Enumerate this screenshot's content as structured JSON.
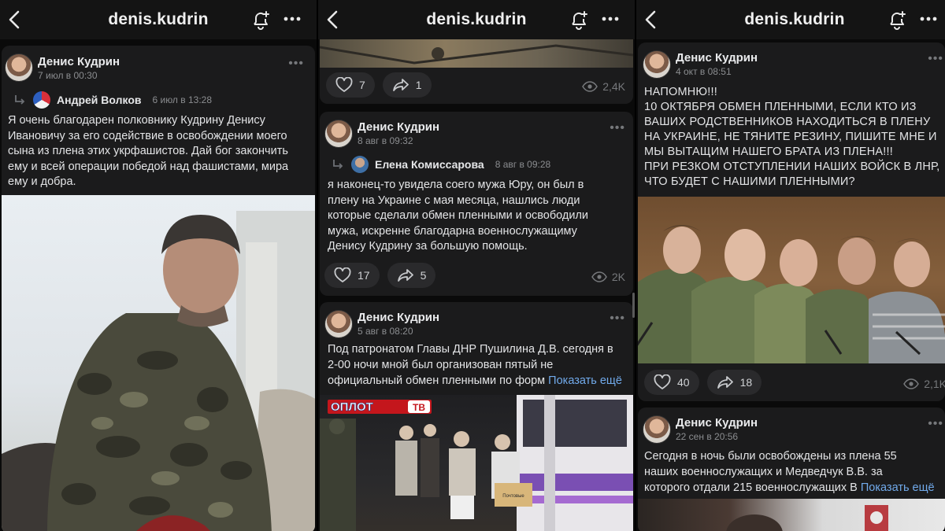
{
  "app": {
    "account": "denis.kudrin"
  },
  "panel1": {
    "post": {
      "author": "Денис Кудрин",
      "date": "7 июл в 00:30",
      "repost_author": "Андрей Волков",
      "repost_date": "6 июл в 13:28",
      "text": "Я очень благодарен полковнику Кудрину Денису\nИвановичу за его содействие в освобождении моего\nсына из плена этих укрфашистов. Дай бог закончить\nему и всей операции победой над фашистами, мира\nему и добра."
    }
  },
  "panel2": {
    "top_stats": {
      "likes": "7",
      "shares": "1",
      "views": "2,4K"
    },
    "post1": {
      "author": "Денис Кудрин",
      "date": "8 авг в 09:32",
      "repost_author": "Елена Комиссарова",
      "repost_date": "8 авг в 09:28",
      "text": "я наконец-то  увидела соего мужа Юру, он был в\nплену на Украине с мая месяца, нашлись люди\nкоторые сделали обмен пленными и освободили\nмужа, искренне благодарна военнослужащиму\nДенису Кудрину за большую помощь.",
      "likes": "17",
      "shares": "5",
      "views": "2K"
    },
    "post2": {
      "author": "Денис Кудрин",
      "date": "5 авг в 08:20",
      "text": "Под патронатом Главы ДНР Пушилина Д.В. сегодня в\n2-00 ночи мной был организован пятый не\nофициальный обмен пленными по форм",
      "show_more": "Показать ещё",
      "logo_text": "ОПЛОТ",
      "logo_tv": "ТВ",
      "box_label": "Почтовые"
    }
  },
  "panel3": {
    "post1": {
      "author": "Денис Кудрин",
      "date": "4 окт в 08:51",
      "text": "НАПОМНЮ!!!\n10 ОКТЯБРЯ ОБМЕН ПЛЕННЫМИ, ЕСЛИ КТО ИЗ\nВАШИХ РОДСТВЕННИКОВ НАХОДИТЬСЯ В ПЛЕНУ\nНА УКРАИНЕ, НЕ ТЯНИТЕ РЕЗИНУ, ПИШИТЕ МНЕ И\nМЫ ВЫТАЩИМ НАШЕГО БРАТА ИЗ ПЛЕНА!!!\nПРИ РЕЗКОМ ОТСТУПЛЕНИИ НАШИХ ВОЙСК В ЛНР,\nЧТО БУДЕТ С НАШИМИ ПЛЕННЫМИ?",
      "likes": "40",
      "shares": "18",
      "views": "2,1K"
    },
    "post2": {
      "author": "Денис Кудрин",
      "date": "22 сен в 20:56",
      "text": "Сегодня в ночь были освобождены из плена  55\nнаших военнослужащих и Медведчук В.В. за\nкоторого отдали 215 военнослужащих В",
      "show_more": "Показать ещё"
    }
  },
  "icons": {
    "back": "chevron-left-icon",
    "bell": "bell-plus-icon",
    "more": "more-horizontal-icon",
    "like": "heart-icon",
    "share": "share-icon",
    "views": "eye-icon"
  },
  "colors": {
    "background": "#0a0a0a",
    "card": "#1b1b1c",
    "link": "#71aaeb",
    "muted": "#8b8d90"
  }
}
